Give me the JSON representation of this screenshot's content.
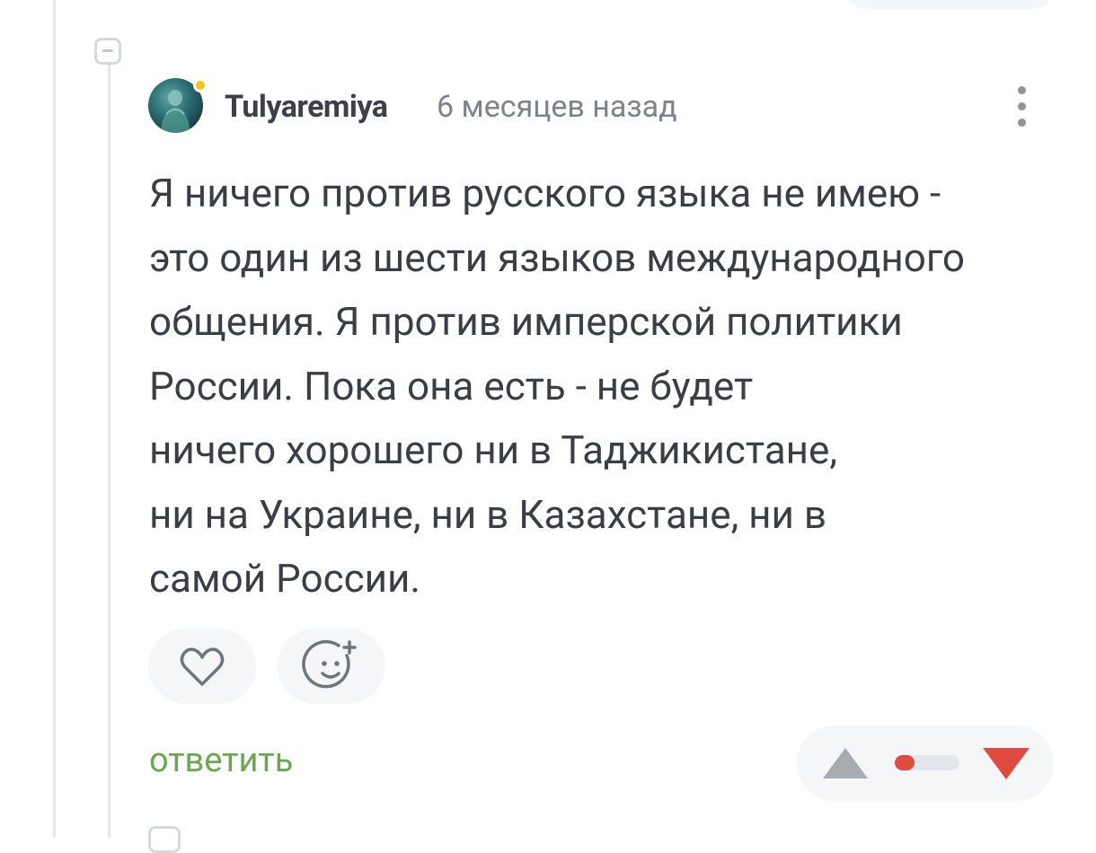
{
  "comment": {
    "author": "Tulyaremiya",
    "time": "6 месяцев назад",
    "text_lines": [
      "Я ничего против русского языка не имею -",
      "это один из шести языков международного",
      "общения. Я против имперской политики",
      "России. Пока она есть - не будет",
      "ничего хорошего ни в Таджикистане,",
      "ни на Украине, ни в Казахстане, ни в",
      "самой России."
    ],
    "reply_label": "ответить"
  },
  "rating": {
    "positive_share": 0.3
  },
  "colors": {
    "accent_green": "#6aa84f",
    "vote_up": "#a6abb0",
    "vote_down": "#e04a3f",
    "rating_fill": "#e04a3f",
    "online": "#f5c518"
  },
  "icons": {
    "collapse": "minus-square-icon",
    "more": "vertical-dots-icon",
    "like": "heart-icon",
    "add_reaction": "smiley-plus-icon",
    "vote_up": "triangle-up-icon",
    "vote_down": "triangle-down-icon"
  }
}
